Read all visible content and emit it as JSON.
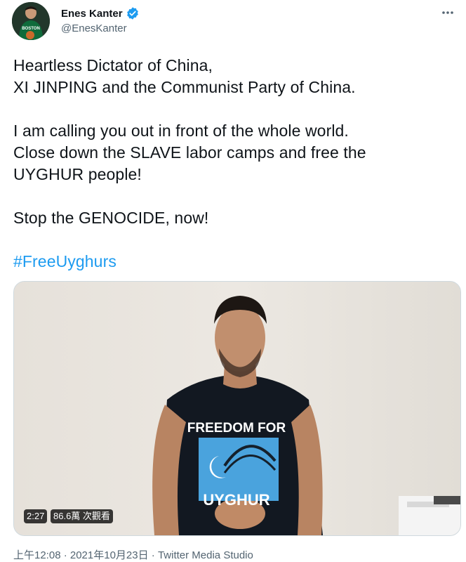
{
  "tweet": {
    "author": {
      "display_name": "Enes Kanter",
      "handle": "@EnesKanter",
      "verified": true,
      "avatar_jersey_text": "BOSTON"
    },
    "text_lines": [
      "Heartless Dictator of China,",
      "XI JINPING and the Communist Party of China.",
      "",
      "I am calling you out in front of the whole world.",
      "Close down the SLAVE labor camps and free the",
      "UYGHUR people!",
      "",
      "Stop the GENOCIDE, now!",
      ""
    ],
    "hashtag": "#FreeUyghurs",
    "media": {
      "duration": "2:27",
      "views": "86.6萬 次觀看",
      "shirt_text_top": "FREEDOM FOR",
      "shirt_text_bottom": "UYGHUR"
    },
    "timestamp": "上午12:08 · 2021年10月23日",
    "separator": " · ",
    "source": "Twitter Media Studio"
  },
  "colors": {
    "accent": "#1d9bf0",
    "text": "#0f1419",
    "secondary": "#536471"
  },
  "icons": {
    "verified": "verified-badge-icon",
    "more": "more-horizontal-icon"
  }
}
